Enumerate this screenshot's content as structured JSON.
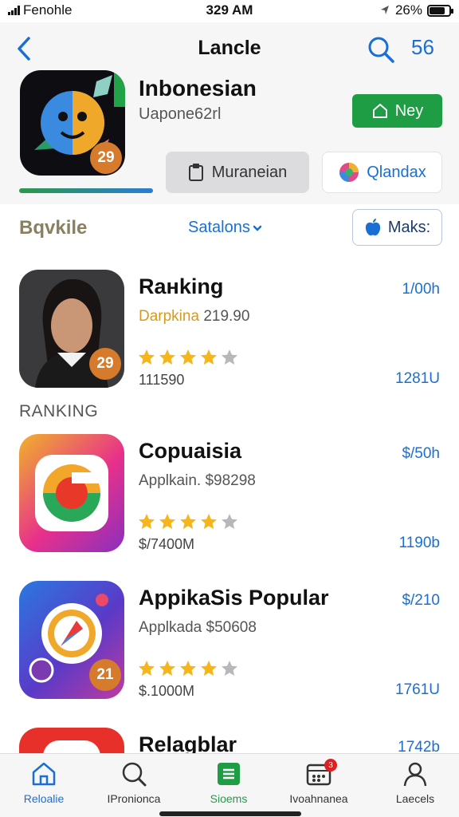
{
  "status": {
    "carrier": "Fenohle",
    "time": "329 AM",
    "battery": "26%",
    "battery_level": 0.8
  },
  "nav": {
    "title": "Lancle",
    "count": "56"
  },
  "hero": {
    "name": "Inbonesian",
    "developer": "Uapone62rl",
    "badge": "29",
    "get_label": "Ney",
    "chip_gray": "Muraneian",
    "chip_white": "Qlandax"
  },
  "filters": {
    "left": "Bqvkile",
    "mid": "Satalons",
    "right": "Maks:"
  },
  "section_label": "RANKING",
  "apps": [
    {
      "name": "Raнking",
      "sub_highlight": "Darpkina",
      "sub_rest": "219.90",
      "rating": 4,
      "meta": "111590",
      "price": "1/00h",
      "size": "1281U",
      "badge": "29"
    },
    {
      "name": "Copuaisia",
      "sub_highlight": "",
      "sub_rest": "Applkain. $98298",
      "rating": 4,
      "meta": "$/7400M",
      "price": "$/50h",
      "size": "1190b",
      "badge": ""
    },
    {
      "name": "AppikaSis Popular",
      "sub_highlight": "",
      "sub_rest": "Applkada $50608",
      "rating": 4,
      "meta": "$.1000M",
      "price": "$/210",
      "size": "1761U",
      "badge": "21"
    },
    {
      "name": "Relagblar",
      "sub_highlight": "",
      "sub_rest": "",
      "rating": 0,
      "meta": "",
      "price": "1742b",
      "size": "",
      "badge": ""
    }
  ],
  "tabs": [
    {
      "label": "Reloalie"
    },
    {
      "label": "IPronionca"
    },
    {
      "label": "Sioems"
    },
    {
      "label": "Ivoahnanea",
      "badge": "3"
    },
    {
      "label": "Laecels"
    }
  ],
  "colors": {
    "accent": "#1a6fd4",
    "green": "#1e9d45",
    "star": "#f5b51b"
  }
}
